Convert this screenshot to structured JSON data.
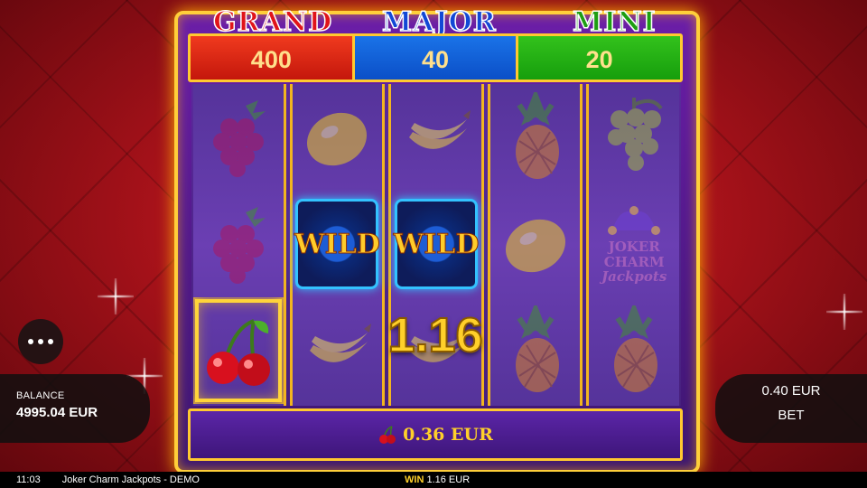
{
  "jackpots": {
    "grand": {
      "title": "GRAND",
      "value": "400"
    },
    "major": {
      "title": "MAJOR",
      "value": "40"
    },
    "mini": {
      "title": "MINI",
      "value": "20"
    }
  },
  "reels": [
    [
      "raspberry",
      "raspberry",
      "cherry"
    ],
    [
      "lemon",
      "wild",
      "banana"
    ],
    [
      "banana",
      "wild",
      "banana"
    ],
    [
      "pineapple",
      "lemon",
      "pineapple"
    ],
    [
      "grapes",
      "joker-logo",
      "pineapple"
    ]
  ],
  "wild_label": "WILD",
  "joker_logo": {
    "line1": "JOKER CHARM",
    "line2": "Jackpots"
  },
  "win_amount": "1.16",
  "win_line": {
    "icon": "cherry-icon",
    "text": "0.36 EUR"
  },
  "balance": {
    "label": "BALANCE",
    "value": "4995.04 EUR"
  },
  "bet": {
    "value": "0.40 EUR",
    "label": "BET"
  },
  "menu_icon": "more-dots-icon",
  "status": {
    "time": "11:03",
    "title": "Joker Charm Jackpots - DEMO",
    "win_label": "WIN",
    "win_value": "1.16 EUR"
  }
}
